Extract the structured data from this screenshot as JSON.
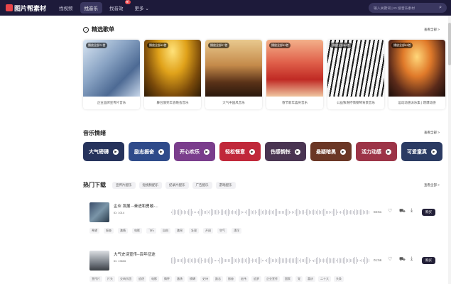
{
  "header": {
    "logo": "图片帮素材",
    "nav": [
      {
        "label": "找视频",
        "active": false,
        "badge": ""
      },
      {
        "label": "找音乐",
        "active": true,
        "badge": ""
      },
      {
        "label": "找音效",
        "active": false,
        "badge": "新"
      },
      {
        "label": "更多",
        "active": false,
        "badge": ""
      }
    ],
    "search_placeholder": "输入关键词 | ID 搜音乐素材"
  },
  "songlist_section": {
    "title": "精选歌单",
    "more": "查看全部 >",
    "cards": [
      {
        "tag": "播放全部71首",
        "caption": "企业品牌宣传片音乐"
      },
      {
        "tag": "播放全部43首",
        "caption": "舞台颁奖年会晚会音乐"
      },
      {
        "tag": "播放全部27首",
        "caption": "大气中国风音乐"
      },
      {
        "tag": "播放全部33首",
        "caption": "春节新年喜庆音乐"
      },
      {
        "tag": "播放全部54首",
        "caption": "公益致谢抒情钢琴背景音乐"
      },
      {
        "tag": "播放全部53首",
        "caption": "运动动感派乐集 | 燃爆动感"
      }
    ]
  },
  "mood_section": {
    "title": "音乐情绪",
    "more": "查看全部 >",
    "moods": [
      {
        "label": "大气磅礴",
        "color": "#26335c"
      },
      {
        "label": "励志振奋",
        "color": "#2f4b8a"
      },
      {
        "label": "开心欢乐",
        "color": "#7a3d8c"
      },
      {
        "label": "轻松惬意",
        "color": "#c0283a"
      },
      {
        "label": "伤感惆怅",
        "color": "#4a3552"
      },
      {
        "label": "悬疑暗黑",
        "color": "#6b3726"
      },
      {
        "label": "活力动感",
        "color": "#9c3447"
      },
      {
        "label": "可爱童真",
        "color": "#2b3b63"
      }
    ]
  },
  "hot_section": {
    "title": "热门下载",
    "more": "查看全部 >",
    "chips": [
      "宣传片配乐",
      "短视频配乐",
      "纪录片配乐",
      "广告配乐",
      "游戏配乐"
    ],
    "tracks": [
      {
        "name": "企业 发展 --奋进和勇敢-...",
        "id": "ID: 1014",
        "duration": "02:51",
        "buy": "购买",
        "tags": [
          "希望",
          "振奋",
          "激情",
          "电影",
          "飞行",
          "自由",
          "激昂",
          "壮观",
          "开阔",
          "空气",
          "漂浮"
        ]
      },
      {
        "name": "大气史诗宣传--百年征途",
        "id": "ID: 19606",
        "duration": "01:56",
        "buy": "购买",
        "tags": [
          "宣传片",
          "片头",
          "交响乐团",
          "追逐",
          "电影",
          "情怀",
          "激扬",
          "磅礴",
          "史诗",
          "励志",
          "振奋",
          "宏伟",
          "追梦",
          "企业宣传",
          "国家",
          "党",
          "喜庆",
          "二十大",
          "头条"
        ]
      }
    ]
  }
}
